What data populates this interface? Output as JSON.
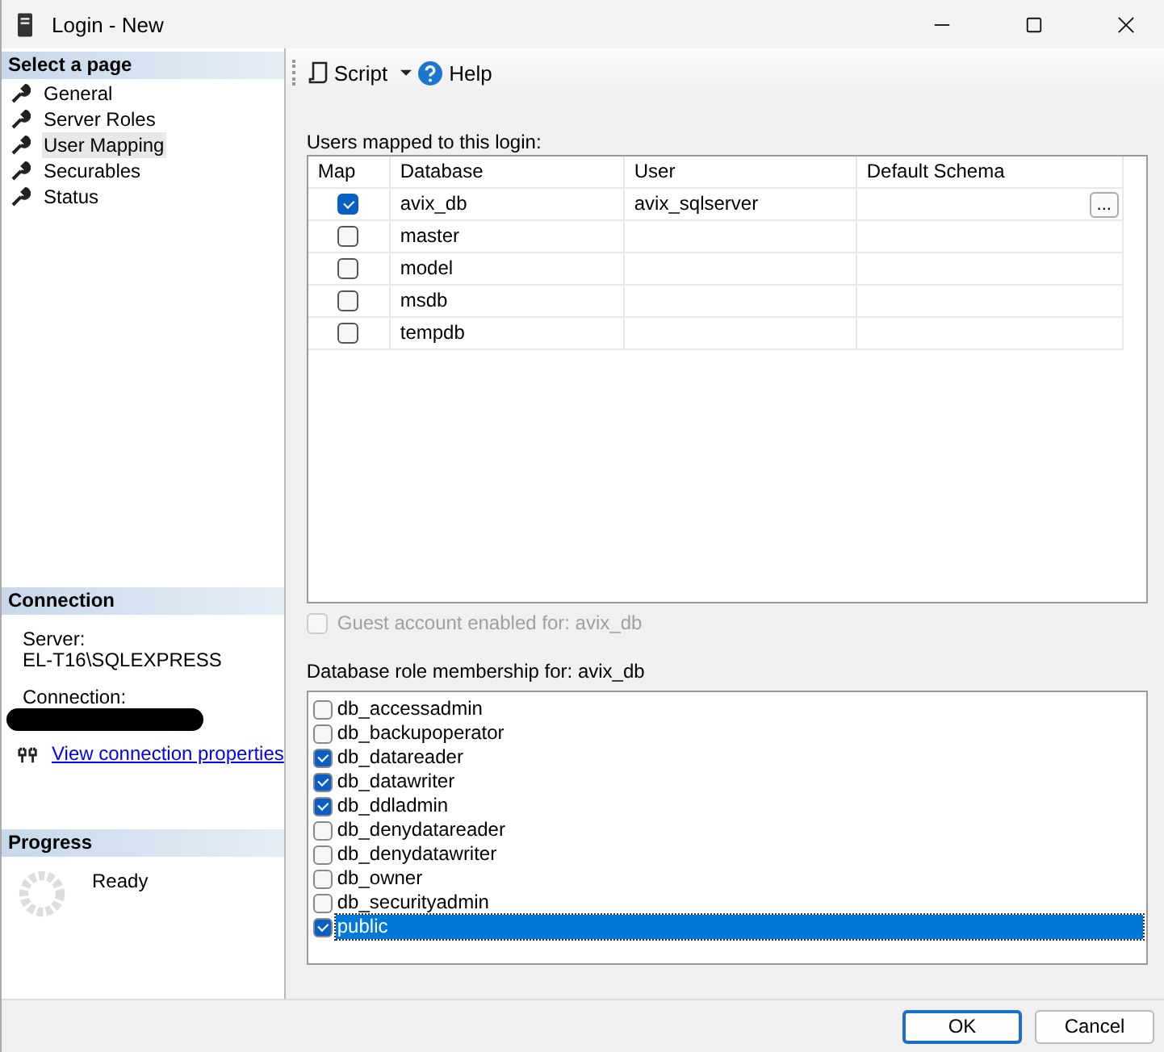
{
  "window": {
    "title": "Login - New"
  },
  "sidebar": {
    "header": "Select a page",
    "items": [
      {
        "label": "General",
        "selected": false
      },
      {
        "label": "Server Roles",
        "selected": false
      },
      {
        "label": "User Mapping",
        "selected": true
      },
      {
        "label": "Securables",
        "selected": false
      },
      {
        "label": "Status",
        "selected": false
      }
    ]
  },
  "connection": {
    "header": "Connection",
    "server_label": "Server:",
    "server": "EL-T16\\SQLEXPRESS",
    "connection_label": "Connection:",
    "link": "View connection properties"
  },
  "progress": {
    "header": "Progress",
    "status": "Ready"
  },
  "toolbar": {
    "script": "Script",
    "help": "Help"
  },
  "mapping": {
    "label": "Users mapped to this login:",
    "columns": [
      "Map",
      "Database",
      "User",
      "Default Schema"
    ],
    "rows": [
      {
        "checked": true,
        "database": "avix_db",
        "user": "avix_sqlserver",
        "schema_button": "..."
      },
      {
        "checked": false,
        "database": "master",
        "user": ""
      },
      {
        "checked": false,
        "database": "model",
        "user": ""
      },
      {
        "checked": false,
        "database": "msdb",
        "user": ""
      },
      {
        "checked": false,
        "database": "tempdb",
        "user": ""
      }
    ]
  },
  "guest": {
    "label": "Guest account enabled for: avix_db",
    "checked": false,
    "disabled": true
  },
  "roles": {
    "label": "Database role membership for: avix_db",
    "items": [
      {
        "name": "db_accessadmin",
        "checked": false,
        "selected": false
      },
      {
        "name": "db_backupoperator",
        "checked": false,
        "selected": false
      },
      {
        "name": "db_datareader",
        "checked": true,
        "selected": false
      },
      {
        "name": "db_datawriter",
        "checked": true,
        "selected": false
      },
      {
        "name": "db_ddladmin",
        "checked": true,
        "selected": false
      },
      {
        "name": "db_denydatareader",
        "checked": false,
        "selected": false
      },
      {
        "name": "db_denydatawriter",
        "checked": false,
        "selected": false
      },
      {
        "name": "db_owner",
        "checked": false,
        "selected": false
      },
      {
        "name": "db_securityadmin",
        "checked": false,
        "selected": false
      },
      {
        "name": "public",
        "checked": true,
        "selected": true
      }
    ]
  },
  "buttons": [
    "OK",
    "Cancel"
  ]
}
